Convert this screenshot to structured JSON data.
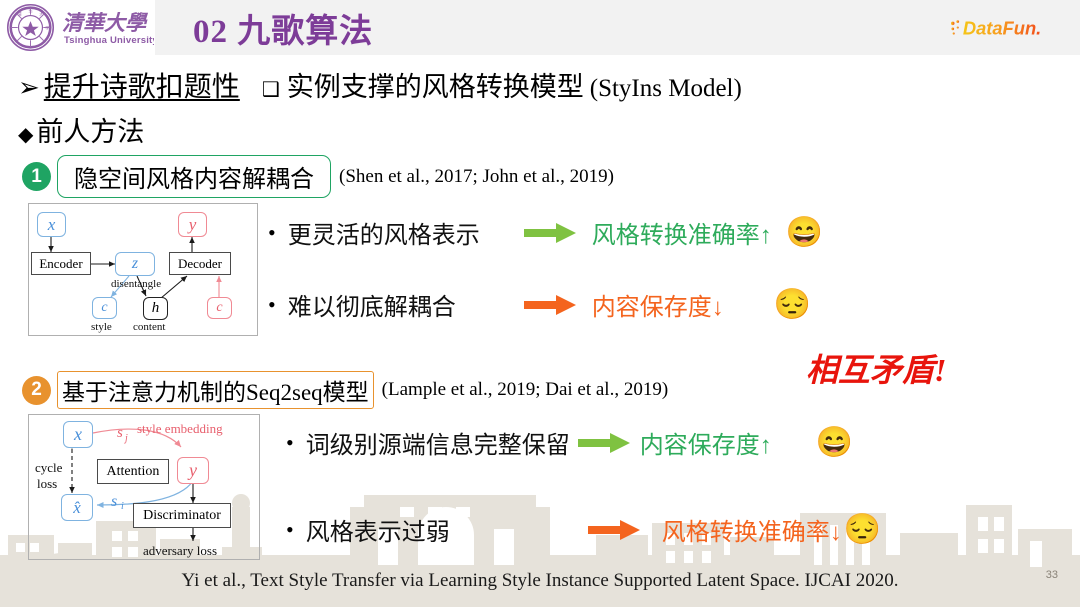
{
  "header": {
    "university_name_cn": "清华大学",
    "university_name_en": "Tsinghua University",
    "slide_title": "02 九歌算法",
    "brand_logo": "datafun-logo",
    "brand_text": "DataFun.",
    "title_color": "#7d3c98",
    "band_color": "#f2f2f2"
  },
  "headings": {
    "bullet_arrow": "➢",
    "topic": "提升诗歌扣题性",
    "square_bullet": "❑",
    "subtopic": "实例支撑的风格转换模型",
    "subtopic_en": "(StyIns Model)",
    "section_diamond": "◆",
    "section_label": "前人方法"
  },
  "sections": [
    {
      "number": "1",
      "number_color": "#1fa463",
      "title": "隐空间风格内容解耦合",
      "citation": "(Shen et al., 2017; John et al., 2019)",
      "figure": {
        "name": "latent-disentangle-diagram",
        "nodes": [
          {
            "id": "x",
            "label": "x",
            "style": "blue-round-italic"
          },
          {
            "id": "encoder",
            "label": "Encoder",
            "style": "dark-rect"
          },
          {
            "id": "z",
            "label": "z",
            "style": "blue-round-italic"
          },
          {
            "id": "decoder",
            "label": "Decoder",
            "style": "dark-rect"
          },
          {
            "id": "y",
            "label": "y",
            "style": "red-round-italic"
          },
          {
            "id": "c_style",
            "label": "c",
            "style": "blue-round-italic"
          },
          {
            "id": "h",
            "label": "h",
            "style": "black-round-italic"
          },
          {
            "id": "c_content",
            "label": "c",
            "style": "red-round-italic"
          }
        ],
        "labels": [
          {
            "id": "disentangle",
            "text": "disentangle"
          },
          {
            "id": "style",
            "text": "style"
          },
          {
            "id": "content",
            "text": "content"
          }
        ]
      },
      "bullets": [
        {
          "text": "更灵活的风格表示",
          "arrow_color": "#7fc241",
          "result": "风格转换准确率↑",
          "result_color": "#2eab5b",
          "emoji": "😄",
          "emoji_name": "grinning-face-emoji"
        },
        {
          "text": "难以彻底解耦合",
          "arrow_color": "#f4641e",
          "result": "内容保存度↓",
          "result_color": "#f4641e",
          "emoji": "😔",
          "emoji_name": "pensive-face-emoji"
        }
      ]
    },
    {
      "number": "2",
      "number_color": "#e8922e",
      "title": "基于注意力机制的Seq2seq模型",
      "citation": "(Lample et al., 2019; Dai et al., 2019)",
      "figure": {
        "name": "seq2seq-attention-diagram",
        "nodes": [
          {
            "id": "x",
            "label": "x",
            "style": "blue-round-italic"
          },
          {
            "id": "attention",
            "label": "Attention",
            "style": "dark-rect"
          },
          {
            "id": "y",
            "label": "y",
            "style": "red-round-italic"
          },
          {
            "id": "xhat",
            "label": "x̂",
            "style": "blue-round-italic"
          },
          {
            "id": "discriminator",
            "label": "Discriminator",
            "style": "dark-rect"
          }
        ],
        "labels": [
          {
            "id": "cycle_loss",
            "text": "cycle"
          },
          {
            "id": "cycle_loss2",
            "text": "loss"
          },
          {
            "id": "style_embedding",
            "text": "style embedding"
          },
          {
            "id": "s_j",
            "text": "s"
          },
          {
            "id": "s_j_sub",
            "text": "j"
          },
          {
            "id": "s_i",
            "text": "s"
          },
          {
            "id": "s_i_sub",
            "text": "i"
          },
          {
            "id": "adversary_loss",
            "text": "adversary loss"
          }
        ]
      },
      "bullets": [
        {
          "text": "词级别源端信息完整保留",
          "arrow_color": "#7fc241",
          "result": "内容保存度↑",
          "result_color": "#2eab5b",
          "emoji": "😄",
          "emoji_name": "grinning-face-emoji"
        },
        {
          "text": "风格表示过弱",
          "arrow_color": "#f4641e",
          "result": "风格转换准确率↓",
          "result_color": "#f4641e",
          "emoji": "😔",
          "emoji_name": "pensive-face-emoji"
        }
      ]
    }
  ],
  "annotation": {
    "contradiction_text": "相互矛盾!",
    "contradiction_color": "#e8140c"
  },
  "footer": {
    "citation": "Yi et al., Text Style Transfer via Learning Style Instance Supported Latent Space. IJCAI 2020.",
    "page_number": "33"
  }
}
